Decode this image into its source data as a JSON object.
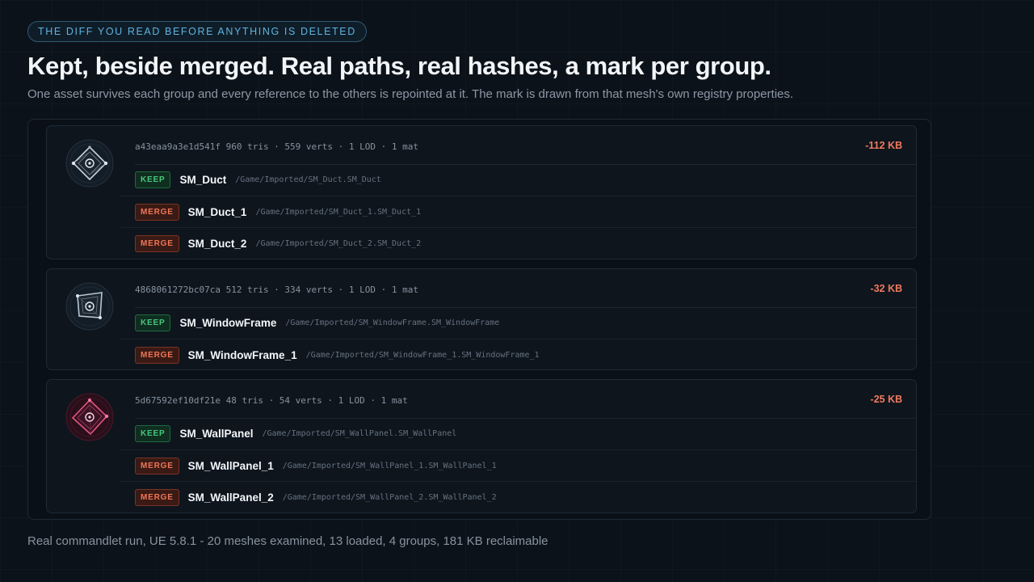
{
  "eyebrow": "THE DIFF YOU READ BEFORE ANYTHING IS DELETED",
  "title": "Kept, beside merged. Real paths, real hashes, a mark per group.",
  "subtitle": "One asset survives each group and every reference to the others is repointed at it. The mark is drawn from that mesh's own registry properties.",
  "colors": {
    "accent": "#5fb3df",
    "keep": "#48c67c",
    "merge": "#ee7758",
    "saving": "#f07a5d"
  },
  "groups": [
    {
      "mark_icon": "registry-mark-icon",
      "mark_color": "#c9d3dc",
      "meta": "a43eaa9a3e1d541f  960 tris · 559 verts · 1 LOD · 1 mat",
      "saving": "-112 KB",
      "rows": [
        {
          "badge": "KEEP",
          "name": "SM_Duct",
          "path": "/Game/Imported/SM_Duct.SM_Duct"
        },
        {
          "badge": "MERGE",
          "name": "SM_Duct_1",
          "path": "/Game/Imported/SM_Duct_1.SM_Duct_1"
        },
        {
          "badge": "MERGE",
          "name": "SM_Duct_2",
          "path": "/Game/Imported/SM_Duct_2.SM_Duct_2"
        }
      ]
    },
    {
      "mark_icon": "registry-mark-icon",
      "mark_color": "#b9c6d2",
      "meta": "4868061272bc07ca  512 tris · 334 verts · 1 LOD · 1 mat",
      "saving": "-32 KB",
      "rows": [
        {
          "badge": "KEEP",
          "name": "SM_WindowFrame",
          "path": "/Game/Imported/SM_WindowFrame.SM_WindowFrame"
        },
        {
          "badge": "MERGE",
          "name": "SM_WindowFrame_1",
          "path": "/Game/Imported/SM_WindowFrame_1.SM_WindowFrame_1"
        }
      ]
    },
    {
      "mark_icon": "registry-mark-icon",
      "mark_color": "#e0567e",
      "meta": "5d67592ef10df21e  48 tris · 54 verts · 1 LOD · 1 mat",
      "saving": "-25 KB",
      "rows": [
        {
          "badge": "KEEP",
          "name": "SM_WallPanel",
          "path": "/Game/Imported/SM_WallPanel.SM_WallPanel"
        },
        {
          "badge": "MERGE",
          "name": "SM_WallPanel_1",
          "path": "/Game/Imported/SM_WallPanel_1.SM_WallPanel_1"
        },
        {
          "badge": "MERGE",
          "name": "SM_WallPanel_2",
          "path": "/Game/Imported/SM_WallPanel_2.SM_WallPanel_2"
        }
      ]
    }
  ],
  "footer": "Real commandlet run, UE 5.8.1 - 20 meshes examined, 13 loaded, 4 groups, 181 KB reclaimable"
}
